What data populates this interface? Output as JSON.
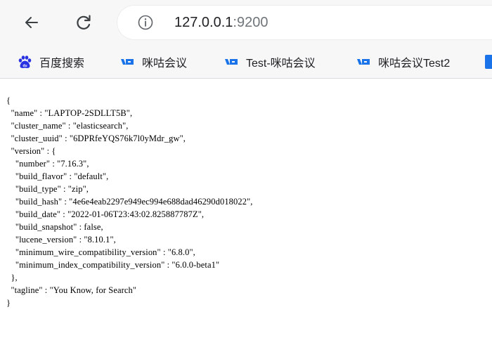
{
  "toolbar": {
    "url_host": "127.0.0.1",
    "url_port": ":9200"
  },
  "bookmarks": [
    {
      "label": "百度搜索",
      "icon": "baidu-paw-icon",
      "color": "#2932e1"
    },
    {
      "label": "咪咕会议",
      "icon": "migu-meeting-icon",
      "color": "#1a73e8"
    },
    {
      "label": "Test-咪咕会议",
      "icon": "migu-meeting-icon",
      "color": "#1a73e8"
    },
    {
      "label": "咪咕会议Test2",
      "icon": "migu-meeting-icon",
      "color": "#1a73e8"
    }
  ],
  "json_lines": [
    "{",
    "  \"name\" : \"LAPTOP-2SDLLT5B\",",
    "  \"cluster_name\" : \"elasticsearch\",",
    "  \"cluster_uuid\" : \"6DPRfeYQS76k7l0yMdr_gw\",",
    "  \"version\" : {",
    "    \"number\" : \"7.16.3\",",
    "    \"build_flavor\" : \"default\",",
    "    \"build_type\" : \"zip\",",
    "    \"build_hash\" : \"4e6e4eab2297e949ec994e688dad46290d018022\",",
    "    \"build_date\" : \"2022-01-06T23:43:02.825887787Z\",",
    "    \"build_snapshot\" : false,",
    "    \"lucene_version\" : \"8.10.1\",",
    "    \"minimum_wire_compatibility_version\" : \"6.8.0\",",
    "    \"minimum_index_compatibility_version\" : \"6.0.0-beta1\"",
    "  },",
    "  \"tagline\" : \"You Know, for Search\"",
    "}"
  ]
}
